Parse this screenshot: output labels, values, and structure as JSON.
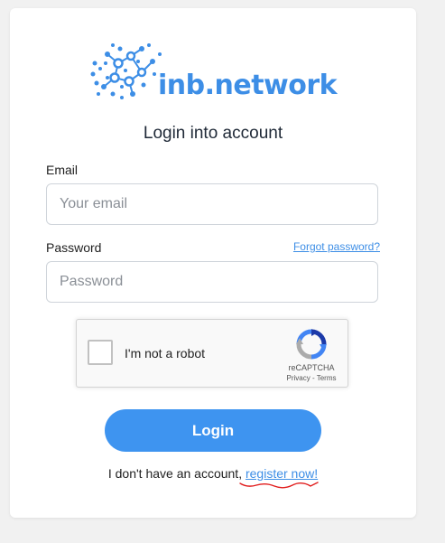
{
  "brand": {
    "name": "inb.network",
    "color": "#3d8ee6"
  },
  "form": {
    "title": "Login into account",
    "email_label": "Email",
    "email_placeholder": "Your email",
    "email_value": "",
    "password_label": "Password",
    "password_placeholder": "Password",
    "password_value": "",
    "forgot_link": "Forgot password?",
    "login_button": "Login",
    "register_prefix": "I don't have an account,",
    "register_link": "register now!",
    "accent_color": "#3e94f0"
  },
  "recaptcha": {
    "checkbox_label": "I'm not a robot",
    "checked": false,
    "brand": "reCAPTCHA",
    "privacy": "Privacy",
    "separator": "-",
    "terms": "Terms",
    "icon": "recaptcha-logo-icon"
  },
  "annotation": {
    "type": "red-underline",
    "color": "#e11d1d"
  }
}
